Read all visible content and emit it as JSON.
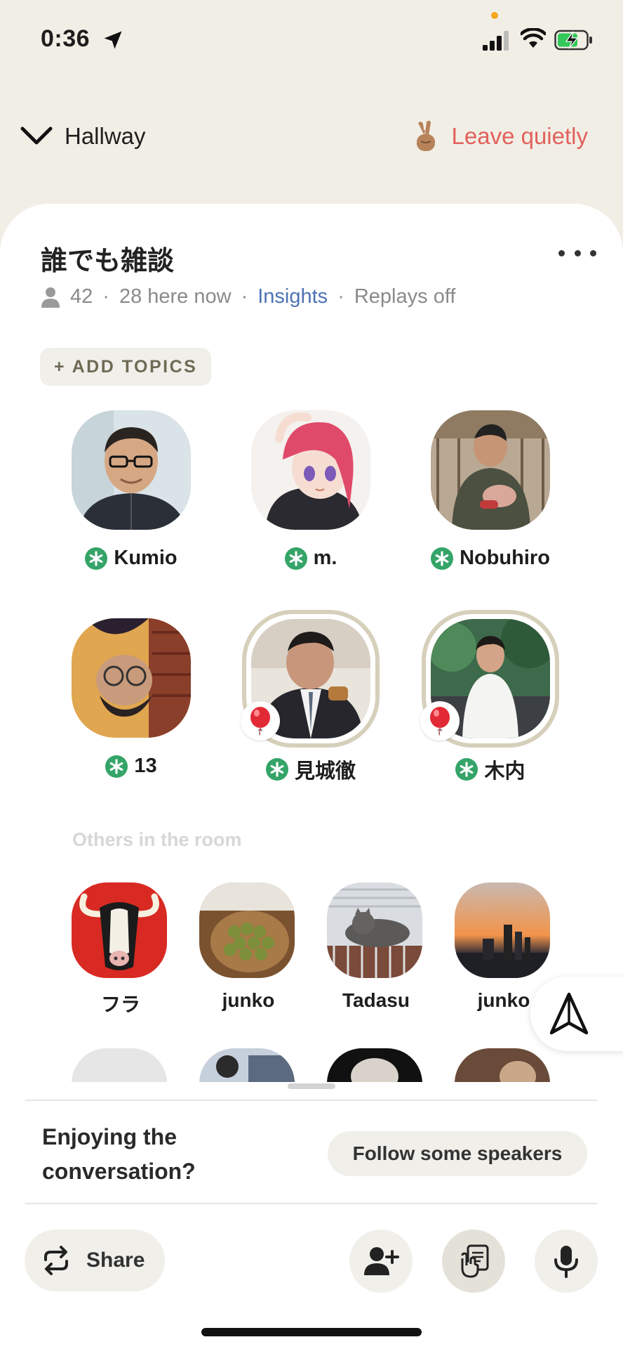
{
  "status_bar": {
    "time": "0:36"
  },
  "header": {
    "back_label": "Hallway",
    "leave_label": "Leave quietly"
  },
  "room": {
    "title": "誰でも雑談",
    "member_count": "42",
    "here_now": "28 here now",
    "insights_label": "Insights",
    "replays": "Replays off",
    "add_topics_label": "+ ADD TOPICS"
  },
  "speakers": [
    {
      "name": "Kumio",
      "moderator": true,
      "ringed": false
    },
    {
      "name": "m.",
      "moderator": true,
      "ringed": false
    },
    {
      "name": "Nobuhiro",
      "moderator": true,
      "ringed": false
    },
    {
      "name": "13",
      "moderator": true,
      "ringed": false
    },
    {
      "name": "見城徹",
      "moderator": true,
      "ringed": true
    },
    {
      "name": "木内",
      "moderator": true,
      "ringed": true
    }
  ],
  "others_label": "Others in the room",
  "listeners": [
    {
      "name": "フラ"
    },
    {
      "name": "junko"
    },
    {
      "name": "Tadasu"
    },
    {
      "name": "junko"
    }
  ],
  "prompt": {
    "text": "Enjoying the conversation?",
    "follow_label": "Follow some speakers"
  },
  "toolbar": {
    "share_label": "Share"
  },
  "colors": {
    "background": "#f1efe5",
    "leave": "#e2605c",
    "insights": "#4d73b3",
    "moderator_badge": "#34a468",
    "ring": "#d6cfba"
  }
}
